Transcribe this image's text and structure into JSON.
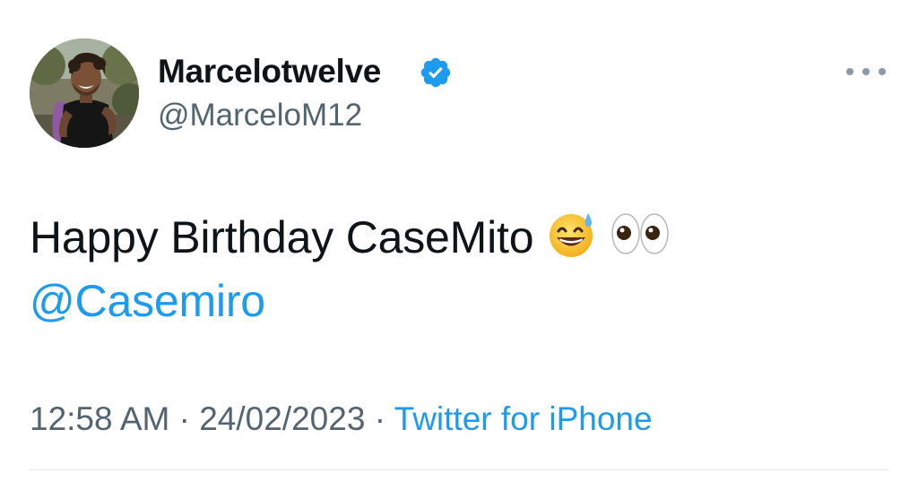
{
  "author": {
    "display_name": "Marcelotwelve",
    "handle": "@MarceloM12",
    "verified": true,
    "verified_color": "#1d9bf0",
    "avatar_icon": "profile-photo"
  },
  "tweet": {
    "text": "Happy Birthday CaseMito",
    "emojis": [
      "grinning-face-with-sweat",
      "eyes"
    ],
    "mention": "@Casemiro"
  },
  "meta": {
    "time": "12:58 AM",
    "separator": "·",
    "date": "24/02/2023",
    "source": "Twitter for iPhone"
  },
  "colors": {
    "link": "#1d9bf0",
    "secondary_text": "#536471",
    "primary_text": "#0f1419"
  }
}
